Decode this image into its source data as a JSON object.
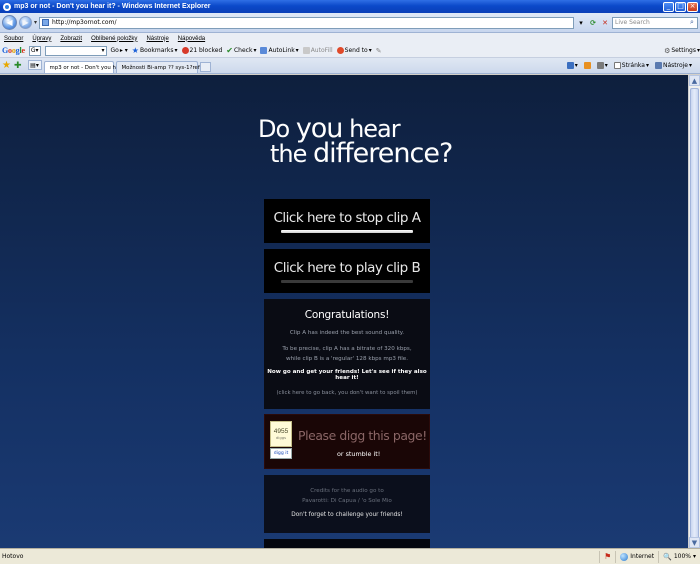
{
  "window": {
    "title": "mp3 or not - Don't you hear it? - Windows Internet Explorer",
    "min": "_",
    "max": "□",
    "close": "×"
  },
  "address": {
    "url": "http://mp3ornot.com/",
    "search_placeholder": "Live Search"
  },
  "menu": [
    "Soubor",
    "Úpravy",
    "Zobrazit",
    "Oblíbené položky",
    "Nástroje",
    "Nápověda"
  ],
  "google_toolbar": {
    "logo": [
      "G",
      "o",
      "o",
      "g",
      "l",
      "e"
    ],
    "engine": "G",
    "go": "Go",
    "bookmarks": "Bookmarks",
    "blocked": "21 blocked",
    "check": "Check",
    "autolink": "AutoLink",
    "autofill": "AutoFill",
    "sendto": "Send to",
    "settings": "Settings"
  },
  "tabs": [
    {
      "label": "mp3 or not - Don't you he...",
      "close": "×"
    },
    {
      "label": "Možnosti Bi-amp ?? sys-1?ref..."
    }
  ],
  "command_bar": {
    "page": "Stránka",
    "tools": "Nástroje"
  },
  "page": {
    "headline": {
      "do": "Do",
      "you": "you",
      "hear": "hear",
      "the": "the",
      "difference": "difference?"
    },
    "clip_a": "Click here to stop clip A",
    "clip_b": "Click here to play clip B",
    "result": {
      "title": "Congratulations!",
      "line1": "Clip A has indeed the best sound quality.",
      "line2": "To be precise, clip A has a bitrate of 320 kbps,",
      "line3": "while clip B is a 'regular' 128 kbps mp3 file.",
      "cta": "Now go and get your friends! Let's see if they also hear it!",
      "back": "(click here to go back, you don't want to spoil them)"
    },
    "digg": {
      "count": "4955",
      "count_label": "diggs",
      "digg_it": "digg it",
      "prompt": "Please digg this page!",
      "stumble": "or stumble it!"
    },
    "credits": {
      "line1": "Credits for the audio go to",
      "line2": "Pavarotti: Di Capua / 'o Sole Mio",
      "challenge": "Don't forget to challenge your friends!"
    }
  },
  "status": {
    "text": "Hotovo",
    "zone": "Internet",
    "zoom": "100%"
  }
}
